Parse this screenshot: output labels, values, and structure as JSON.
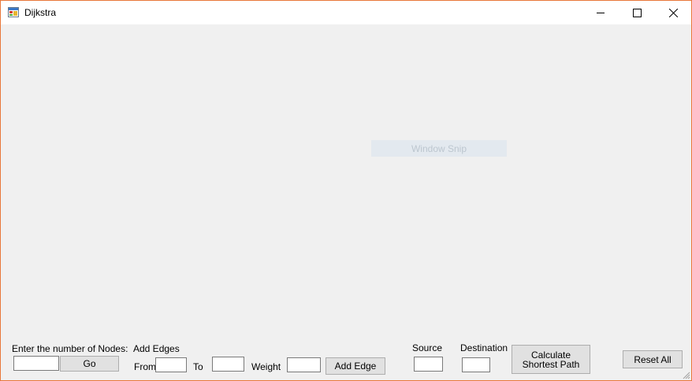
{
  "window": {
    "title": "Dijkstra",
    "app_icon": "windows-form-icon",
    "controls": {
      "minimize": "minimize-icon",
      "maximize": "maximize-icon",
      "close": "close-icon"
    }
  },
  "overlay": {
    "snip_label": "Window Snip"
  },
  "nodes": {
    "label": "Enter the number of Nodes:",
    "value": "",
    "go_label": "Go"
  },
  "edges": {
    "header": "Add Edges",
    "from_label": "From",
    "from_value": "",
    "to_label": "To",
    "to_value": "",
    "weight_label": "Weight",
    "weight_value": "",
    "add_label": "Add Edge"
  },
  "path": {
    "source_label": "Source",
    "source_value": "",
    "destination_label": "Destination",
    "destination_value": "",
    "calc_line1": "Calculate",
    "calc_line2": "Shortest Path"
  },
  "reset_label": "Reset All",
  "colors": {
    "window_border": "#e8773a",
    "client_bg": "#f0f0f0",
    "button_bg": "#e1e1e1"
  }
}
